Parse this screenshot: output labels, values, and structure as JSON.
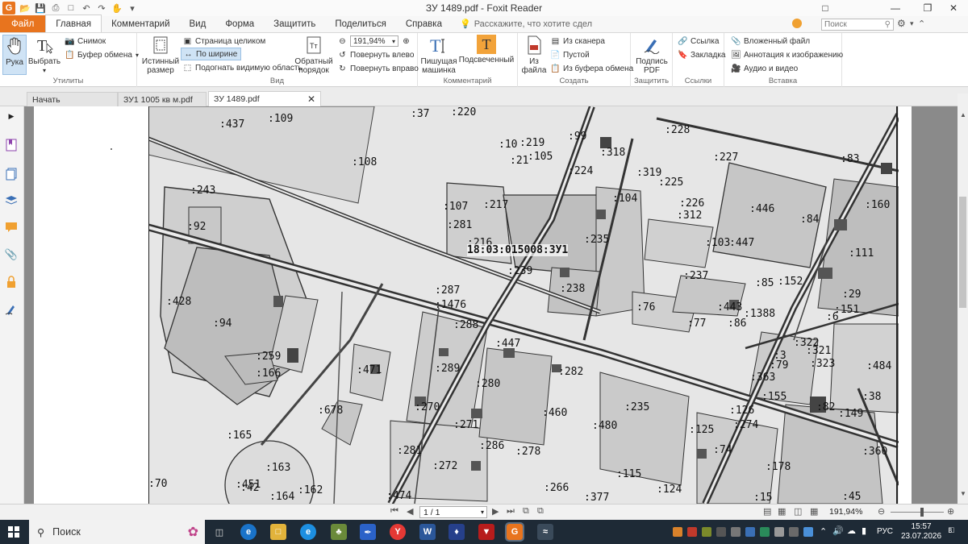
{
  "window": {
    "title": "ЗУ 1489.pdf - Foxit Reader",
    "logo": "G"
  },
  "menu": {
    "file": "Файл",
    "tabs": [
      "Главная",
      "Комментарий",
      "Вид",
      "Форма",
      "Защитить",
      "Поделиться",
      "Справка"
    ],
    "tell_me": "Расскажите, что хотите сдел",
    "search_placeholder": "Поиск"
  },
  "ribbon": {
    "utilities": {
      "label": "Утилиты",
      "hand": "Рука",
      "select": "Выбрать",
      "snapshot": "Снимок",
      "clipboard": "Буфер обмена"
    },
    "view": {
      "label": "Вид",
      "actual_size": [
        "Истинный",
        "размер"
      ],
      "fit_page": "Страница целиком",
      "fit_width": "По ширине",
      "fit_visible": "Подогнать видимую область",
      "reflow": [
        "Обратный",
        "порядок"
      ],
      "zoom": "191,94%",
      "rotate_left": "Повернуть влево",
      "rotate_right": "Повернуть вправо"
    },
    "comment": {
      "label": "Комментарий",
      "typewriter": [
        "Пишущая",
        "машинка"
      ],
      "highlight": "Подсвеченный"
    },
    "create": {
      "label": "Создать",
      "from_file": [
        "Из",
        "файла"
      ],
      "from_scanner": "Из сканера",
      "blank": "Пустой",
      "from_clipboard": "Из буфера обмена"
    },
    "protect": {
      "label": "Защитить",
      "sign": [
        "Подпись",
        "PDF"
      ]
    },
    "links": {
      "label": "Ссылки",
      "link": "Ссылка",
      "bookmark": "Закладка"
    },
    "insert": {
      "label": "Вставка",
      "attachment": "Вложенный файл",
      "image_annotation": "Аннотация к изображению",
      "audio_video": "Аудио и видео"
    }
  },
  "doc_tabs": [
    "Начать",
    "ЗУ1 1005 кв м.pdf",
    "ЗУ 1489.pdf"
  ],
  "map_labels": {
    "main": "18:03:015008:ЗУ1",
    "items": [
      ":437",
      ":109",
      ":37",
      ":220",
      ":228",
      ":99",
      ":318",
      ":10",
      ":219",
      ":105",
      ":21",
      ":227",
      ":83",
      ":108",
      ":224",
      ":319",
      ":225",
      ":243",
      ":104",
      ":226",
      ":312",
      ":446",
      ":84",
      ":160",
      ":107",
      ":217",
      ":92",
      ":281",
      ":235",
      ":103",
      ":447",
      ":111",
      ":239",
      ":237",
      ":85",
      ":152",
      ":287",
      ":238",
      ":29",
      ":1476",
      ":428",
      ":76",
      ":443",
      ":151",
      ":1388",
      ":6",
      ":94",
      ":288",
      ":77",
      ":86",
      ":447",
      ":322",
      ":321",
      ":259",
      ":3",
      ":79",
      ":323",
      ":484",
      ":471",
      ":289",
      ":166",
      ":282",
      ":363",
      ":280",
      ":155",
      ":38",
      ":678",
      ":270",
      ":460",
      ":235",
      ":126",
      ":82",
      ":149",
      ":274",
      ":271",
      ":480",
      ":125",
      ":165",
      ":286",
      ":281",
      ":278",
      ":74",
      ":360",
      ":272",
      ":163",
      ":178",
      ":115",
      ":70",
      ":451",
      ":162",
      ":164",
      ":474",
      ":266",
      ":124",
      ":377",
      ":45",
      ":15",
      ":42",
      ":216"
    ]
  },
  "status": {
    "page": "1 / 1",
    "zoom": "191,94%"
  },
  "taskbar": {
    "search": "Поиск",
    "lang": "РУС",
    "time": "15:57",
    "date": "23.07.2026",
    "notif": "8"
  }
}
